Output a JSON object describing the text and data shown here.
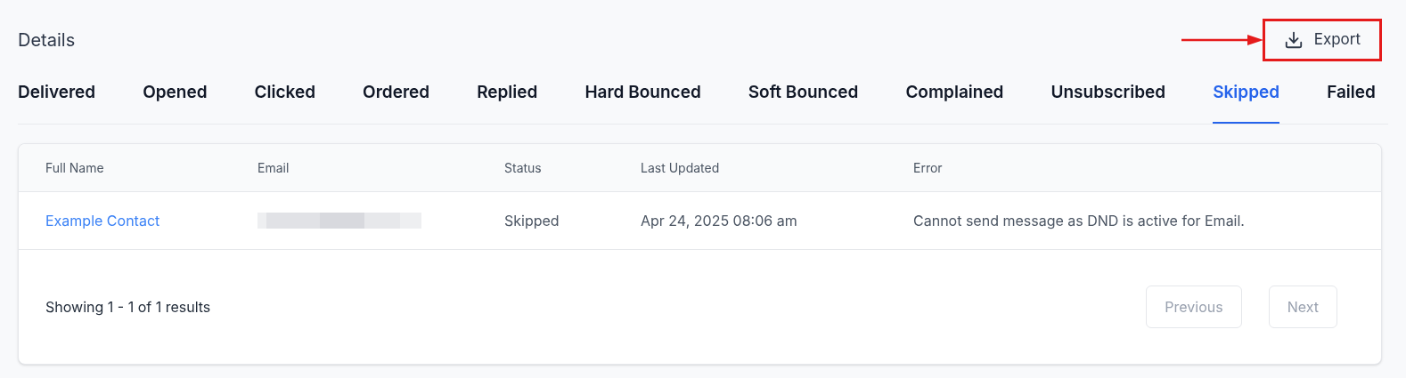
{
  "title": "Details",
  "export_button": {
    "label": "Export",
    "highlighted": true
  },
  "tabs": [
    {
      "label": "Delivered",
      "selected": false
    },
    {
      "label": "Opened",
      "selected": false
    },
    {
      "label": "Clicked",
      "selected": false
    },
    {
      "label": "Ordered",
      "selected": false
    },
    {
      "label": "Replied",
      "selected": false
    },
    {
      "label": "Hard Bounced",
      "selected": false
    },
    {
      "label": "Soft Bounced",
      "selected": false
    },
    {
      "label": "Complained",
      "selected": false
    },
    {
      "label": "Unsubscribed",
      "selected": false
    },
    {
      "label": "Skipped",
      "selected": true
    },
    {
      "label": "Failed",
      "selected": false
    }
  ],
  "table": {
    "columns": [
      "Full Name",
      "Email",
      "Status",
      "Last Updated",
      "Error"
    ],
    "rows": [
      {
        "full_name": "Example Contact",
        "email_redacted": true,
        "status": "Skipped",
        "last_updated": "Apr 24, 2025 08:06 am",
        "error": "Cannot send message as DND is active for Email."
      }
    ]
  },
  "pagination": {
    "summary": "Showing 1 - 1 of 1 results",
    "previous": {
      "label": "Previous",
      "disabled": true
    },
    "next": {
      "label": "Next",
      "disabled": true
    }
  }
}
